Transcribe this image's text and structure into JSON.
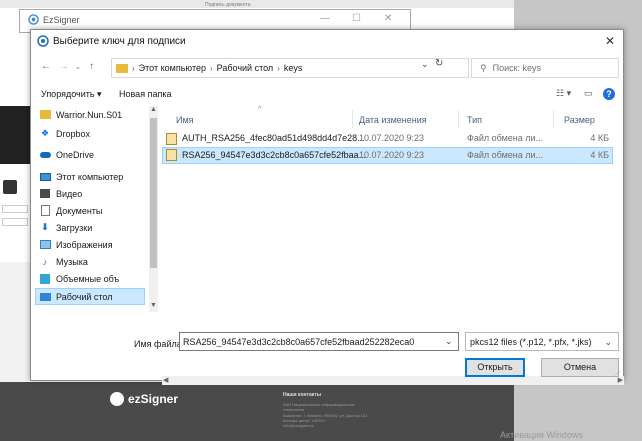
{
  "background": {
    "caption": "Подпись документа",
    "footer_logo": "ezSigner",
    "footer_title": "Наши контакты",
    "footer_lines": [
      "ЗАО Национальные информационные",
      "технологии",
      "Казахстан, г. Алматы, 050000, ул. Достык 121",
      "Контакт-центр: 1402/1+",
      "info@ezsigner.kz"
    ],
    "activate": "Активация Windows"
  },
  "parent_window": {
    "title": "EzSigner"
  },
  "dialog": {
    "title": "Выберите ключ для подписи",
    "address": {
      "crumbs": [
        "Этот компьютер",
        "Рабочий стол",
        "keys"
      ]
    },
    "search": {
      "placeholder": "Поиск: keys"
    },
    "toolbar": {
      "organize": "Упорядочить ▾",
      "new_folder": "Новая папка"
    },
    "sidebar": {
      "items": [
        {
          "label": "Warrior.Nun.S01",
          "icon": "folder-icon"
        },
        {
          "label": "Dropbox",
          "icon": "dropbox-icon"
        },
        {
          "label": "OneDrive",
          "icon": "cloud-icon"
        },
        {
          "label": "Этот компьютер",
          "icon": "computer-icon"
        },
        {
          "label": "Видео",
          "icon": "video-icon"
        },
        {
          "label": "Документы",
          "icon": "document-icon"
        },
        {
          "label": "Загрузки",
          "icon": "download-icon"
        },
        {
          "label": "Изображения",
          "icon": "image-icon"
        },
        {
          "label": "Музыка",
          "icon": "music-icon"
        },
        {
          "label": "Объемные объ",
          "icon": "cube-icon"
        },
        {
          "label": "Рабочий стол",
          "icon": "desktop-icon"
        }
      ]
    },
    "columns": {
      "name": "Имя",
      "date": "Дата изменения",
      "type": "Тип",
      "size": "Размер"
    },
    "files": [
      {
        "name": "AUTH_RSA256_4fec80ad51d498dd4d7e28...",
        "date": "10.07.2020 9:23",
        "type": "Файл обмена ли...",
        "size": "4 КБ"
      },
      {
        "name": "RSA256_94547e3d3c2cb8c0a657cfe52fbaa...",
        "date": "10.07.2020 9:23",
        "type": "Файл обмена ли...",
        "size": "4 КБ"
      }
    ],
    "filename_label": "Имя файла:",
    "filename_value": "RSA256_94547e3d3c2cb8c0a657cfe52fbaad252282eca0",
    "filetype": "pkcs12 files (*.p12, *.pfx, *.jks)",
    "open_label": "Открыть",
    "cancel_label": "Отмена"
  },
  "colors": {
    "selection": "#cce8ff",
    "selection_border": "#99d1ff",
    "accent": "#0078d7",
    "folder": "#e8b93a"
  }
}
